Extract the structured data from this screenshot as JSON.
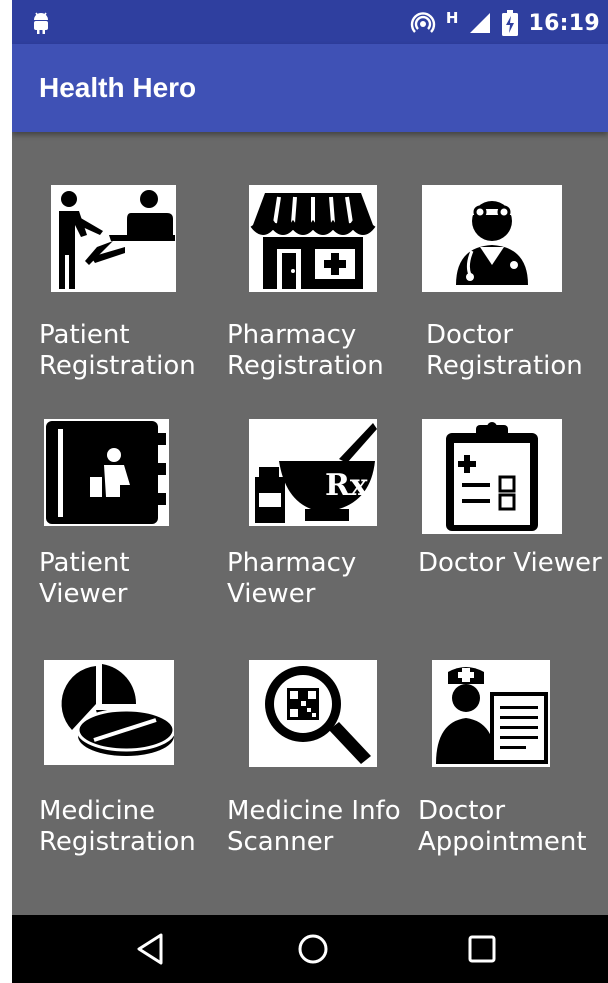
{
  "status_bar": {
    "time": "16:19",
    "network_label": "H",
    "icons": [
      "android-debug-icon",
      "hotspot-icon",
      "signal-icon",
      "battery-charging-icon"
    ]
  },
  "app_bar": {
    "title": "Health Hero"
  },
  "grid": {
    "tiles": [
      {
        "label": "Patient\nRegistration",
        "icon": "patient-registration-icon"
      },
      {
        "label": "Pharmacy\nRegistration",
        "icon": "pharmacy-store-icon"
      },
      {
        "label": "Doctor\nRegistration",
        "icon": "doctor-icon"
      },
      {
        "label": "Patient\nViewer",
        "icon": "patient-book-icon"
      },
      {
        "label": "Pharmacy\nViewer",
        "icon": "mortar-rx-icon"
      },
      {
        "label": "Doctor Viewer",
        "icon": "clipboard-icon"
      },
      {
        "label": "Medicine\nRegistration",
        "icon": "pills-icon"
      },
      {
        "label": "Medicine Info\nScanner",
        "icon": "qr-magnifier-icon"
      },
      {
        "label": "Doctor\nAppointment",
        "icon": "nurse-document-icon"
      }
    ]
  },
  "nav_bar": {
    "buttons": [
      "back-icon",
      "home-icon",
      "recents-icon"
    ]
  },
  "colors": {
    "status_bar": "#2f3f9f",
    "app_bar": "#3f51b5",
    "background": "#696969",
    "nav_bar": "#000000"
  }
}
